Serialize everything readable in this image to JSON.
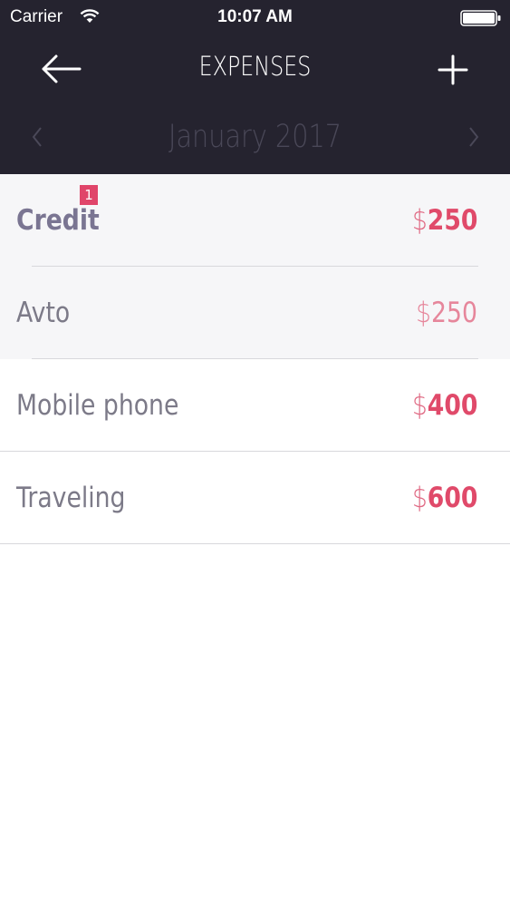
{
  "status_bar": {
    "carrier": "Carrier",
    "time": "10:07 AM"
  },
  "nav": {
    "title": "EXPENSES"
  },
  "month": {
    "label": "January  2017"
  },
  "expenses": [
    {
      "name": "Credit",
      "currency": "$",
      "amount": "250",
      "badge": "1"
    },
    {
      "name": "Avto",
      "currency": "$",
      "amount": "250"
    },
    {
      "name": "Mobile phone",
      "currency": "$",
      "amount": "400"
    },
    {
      "name": "Traveling",
      "currency": "$",
      "amount": "600"
    }
  ],
  "colors": {
    "header_bg": "#25232f",
    "accent": "#e04a6a",
    "badge": "#e0456a"
  }
}
